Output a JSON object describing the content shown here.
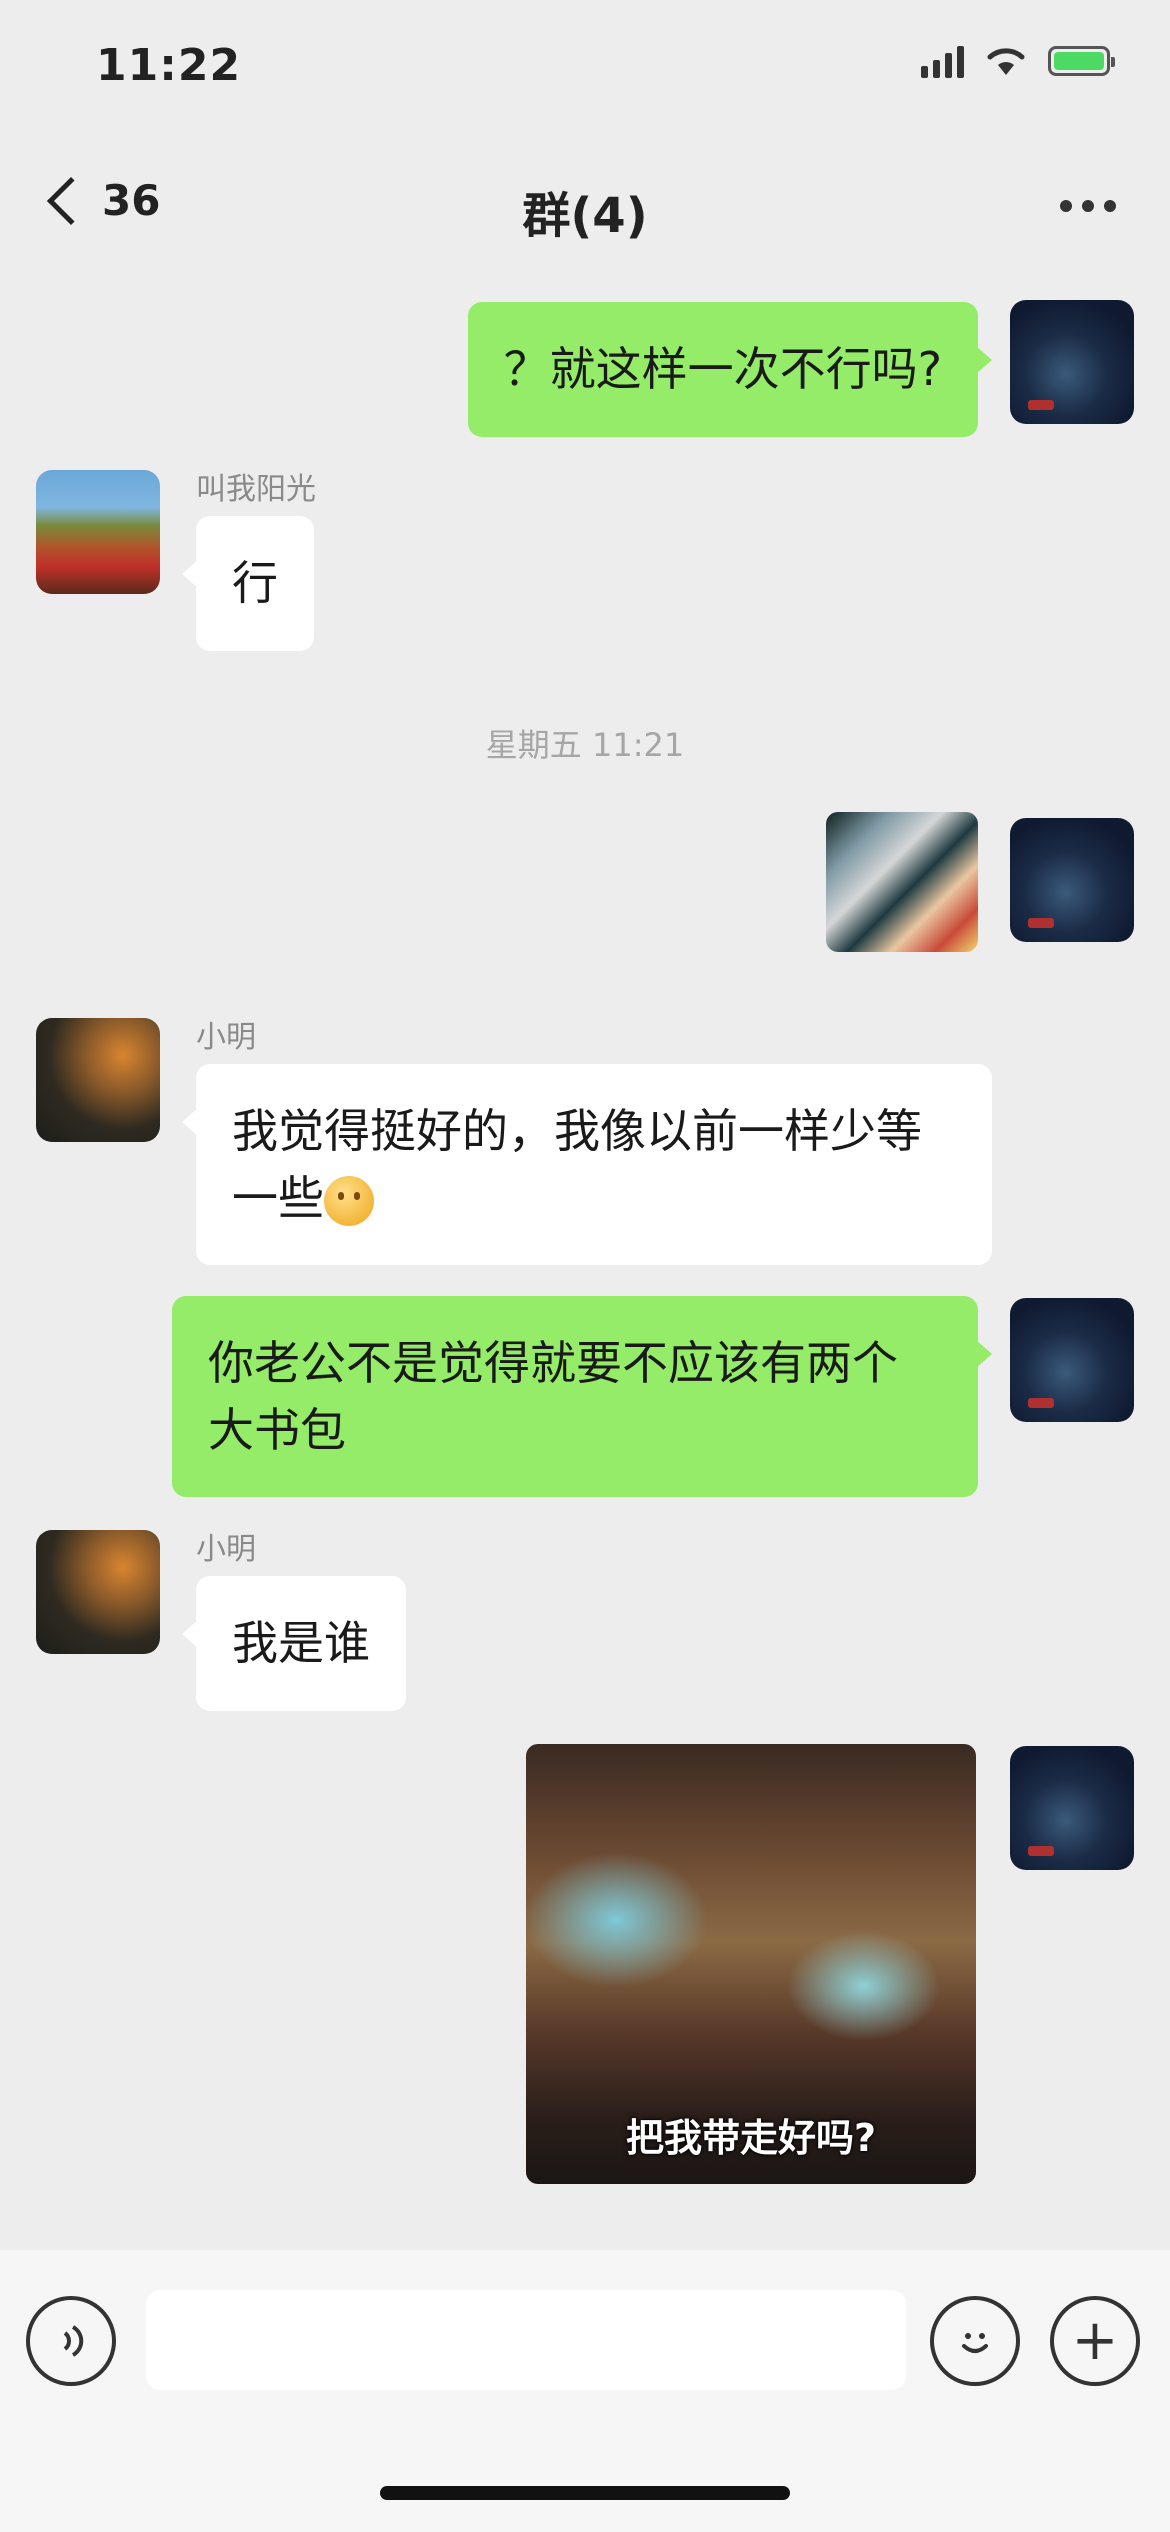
{
  "status_bar": {
    "time": "11:22"
  },
  "nav": {
    "back_count": "36",
    "title": "群(4)"
  },
  "messages": [
    {
      "id": "m1",
      "side": "right",
      "type": "text",
      "text": "？就这样一次不行吗?"
    },
    {
      "id": "m2",
      "side": "left",
      "sender": "叫我阳光",
      "type": "text",
      "text": "行"
    },
    {
      "id": "m3",
      "side": "right",
      "type": "image"
    },
    {
      "id": "m4",
      "side": "left",
      "sender": "小明",
      "type": "text",
      "text": "我觉得挺好的，我像以前一样少等一些",
      "emoji": "smile-emoji"
    },
    {
      "id": "m5",
      "side": "right",
      "type": "text",
      "text": "你老公不是觉得就要不应该有两个大书包"
    },
    {
      "id": "m6",
      "side": "left",
      "sender": "小明",
      "type": "text",
      "text": "我是谁"
    },
    {
      "id": "m7",
      "side": "right",
      "type": "image",
      "caption": "把我带走好吗?"
    }
  ],
  "timestamp": "星期五 11:21",
  "input": {
    "placeholder": ""
  }
}
